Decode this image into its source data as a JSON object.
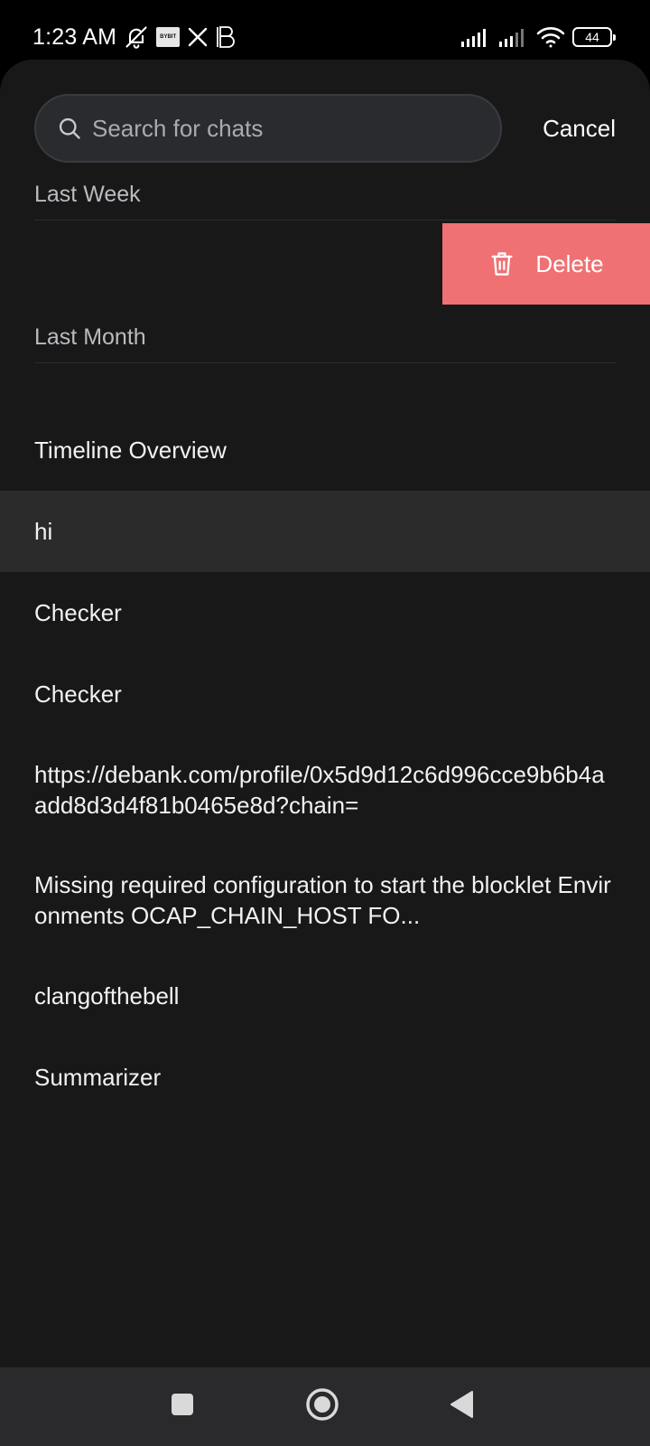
{
  "status_bar": {
    "time": "1:23 AM",
    "battery": "44",
    "bybit_badge": "BYBIT",
    "icons": [
      "bell-off-icon",
      "bybit-icon",
      "x-logo-icon",
      "b-app-icon",
      "signal-icon",
      "signal-icon",
      "wifi-icon",
      "battery-icon"
    ]
  },
  "search": {
    "placeholder": "Search for chats",
    "value": "",
    "cancel_label": "Cancel"
  },
  "sections": {
    "last_week": "Last Week",
    "last_month": "Last Month"
  },
  "swipe_action": {
    "delete_label": "Delete",
    "color": "#f07173"
  },
  "chats": [
    {
      "title": "Timeline Overview"
    },
    {
      "title": "hi"
    },
    {
      "title": "Checker"
    },
    {
      "title": "Checker"
    },
    {
      "title": "https://debank.com/profile/0x5d9d12c6d996cce9b6b4aadd8d3d4f81b0465e8d?chain="
    },
    {
      "title": "Missing required configuration to start the blocklet Environments OCAP_CHAIN_HOST FO..."
    },
    {
      "title": "clangofthebell"
    },
    {
      "title": "Summarizer"
    }
  ],
  "nav": {
    "icons": [
      "recent-apps-icon",
      "home-icon",
      "back-icon"
    ]
  },
  "colors": {
    "sheet_bg": "#181819",
    "selected_row": "#2b2b2c",
    "delete_red": "#f07173"
  }
}
